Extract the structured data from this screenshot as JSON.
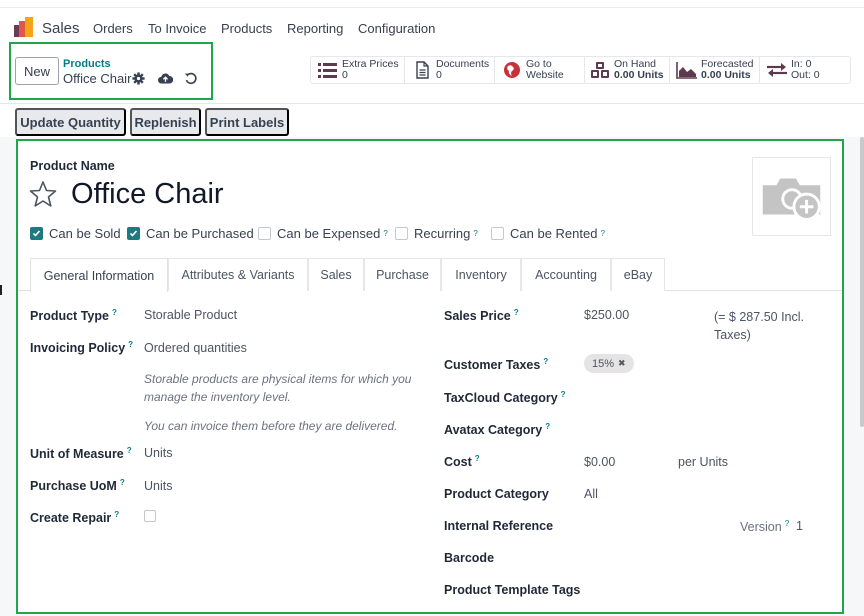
{
  "navbar": {
    "app_name": "Sales",
    "menu": [
      "Orders",
      "To Invoice",
      "Products",
      "Reporting",
      "Configuration"
    ]
  },
  "control_panel": {
    "new_label": "New",
    "breadcrumb_parent": "Products",
    "breadcrumb_current": "Office Chair",
    "icons": [
      "gear-icon",
      "cloud-upload-icon",
      "undo-icon"
    ]
  },
  "smart_buttons": [
    {
      "icon": "list-icon",
      "line1": "Extra Prices",
      "line2": "0"
    },
    {
      "icon": "document-icon",
      "line1": "Documents",
      "line2": "0"
    },
    {
      "icon": "globe-icon",
      "line1": "Go to",
      "line2": "Website"
    },
    {
      "icon": "cubes-icon",
      "line1": "On Hand",
      "line2": "0.00 Units"
    },
    {
      "icon": "area-chart-icon",
      "line1": "Forecasted",
      "line2": "0.00 Units"
    },
    {
      "icon": "exchange-icon",
      "line1": "In: 0",
      "line2": "Out: 0"
    }
  ],
  "actions": [
    "Update Quantity",
    "Replenish",
    "Print Labels"
  ],
  "product": {
    "name_label": "Product Name",
    "name": "Office Chair",
    "favorite": false,
    "flags": [
      {
        "label": "Can be Sold",
        "checked": true,
        "help": false
      },
      {
        "label": "Can be Purchased",
        "checked": true,
        "help": false
      },
      {
        "label": "Can be Expensed",
        "checked": false,
        "help": true
      },
      {
        "label": "Recurring",
        "checked": false,
        "help": true
      },
      {
        "label": "Can be Rented",
        "checked": false,
        "help": true
      }
    ]
  },
  "tabs": [
    {
      "label": "General Information",
      "active": true
    },
    {
      "label": "Attributes & Variants",
      "active": false
    },
    {
      "label": "Sales",
      "active": false
    },
    {
      "label": "Purchase",
      "active": false
    },
    {
      "label": "Inventory",
      "active": false
    },
    {
      "label": "Accounting",
      "active": false
    },
    {
      "label": "eBay",
      "active": false
    }
  ],
  "general": {
    "left": {
      "product_type": {
        "label": "Product Type",
        "value": "Storable Product"
      },
      "invoicing_policy": {
        "label": "Invoicing Policy",
        "value": "Ordered quantities"
      },
      "note1": "Storable products are physical items for which you manage the inventory level.",
      "note2": "You can invoice them before they are delivered.",
      "uom": {
        "label": "Unit of Measure",
        "value": "Units"
      },
      "purchase_uom": {
        "label": "Purchase UoM",
        "value": "Units"
      },
      "create_repair": {
        "label": "Create Repair",
        "checked": false
      }
    },
    "right": {
      "sales_price": {
        "label": "Sales Price",
        "value": "$250.00",
        "incl_taxes": "(= $ 287.50 Incl. Taxes)"
      },
      "customer_taxes": {
        "label": "Customer Taxes",
        "tag": "15%"
      },
      "taxcloud_category": {
        "label": "TaxCloud Category",
        "value": ""
      },
      "avatax_category": {
        "label": "Avatax Category",
        "value": ""
      },
      "cost": {
        "label": "Cost",
        "value": "$0.00",
        "unit": "per Units"
      },
      "product_category": {
        "label": "Product Category",
        "value": "All"
      },
      "internal_reference": {
        "label": "Internal Reference",
        "value": ""
      },
      "version": {
        "label": "Version",
        "value": "1"
      },
      "barcode": {
        "label": "Barcode",
        "value": ""
      },
      "template_tags": {
        "label": "Product Template Tags",
        "value": ""
      }
    }
  },
  "colors": {
    "accent": "#017e84",
    "checkbox": "#1f7a80",
    "smart_icon": "#5f3a4f",
    "highlight": "#21a54a"
  }
}
